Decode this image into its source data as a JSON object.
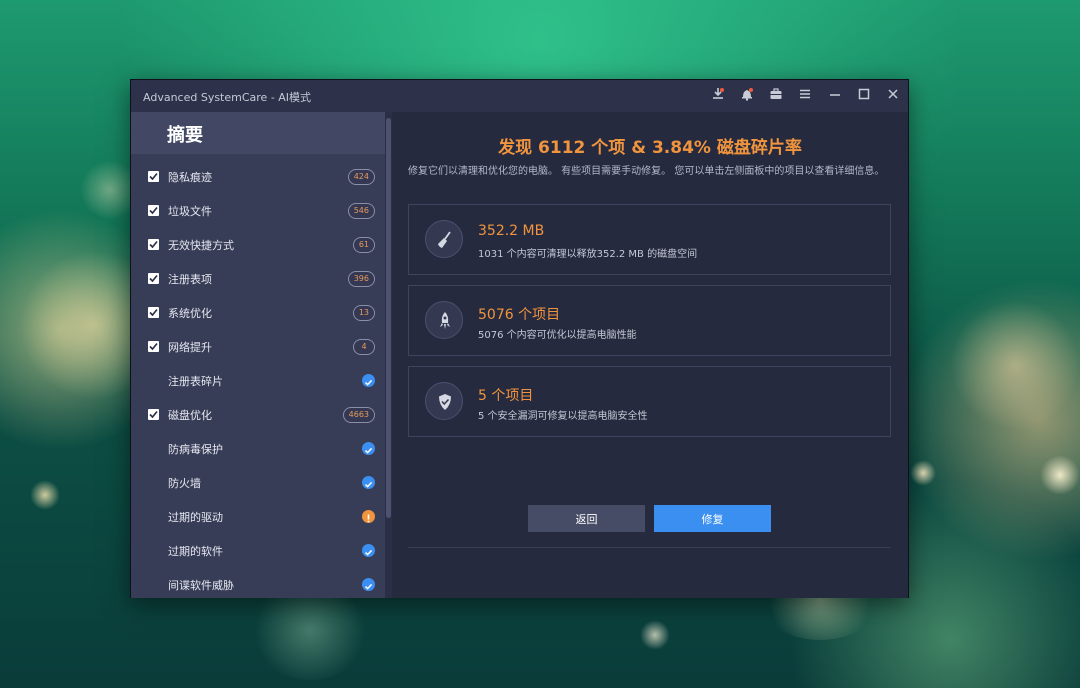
{
  "window": {
    "title": "Advanced SystemCare - AI模式"
  },
  "sidebar": {
    "header": "摘要",
    "items": [
      {
        "label": "隐私痕迹",
        "checked": true,
        "badge": "424"
      },
      {
        "label": "垃圾文件",
        "checked": true,
        "badge": "546"
      },
      {
        "label": "无效快捷方式",
        "checked": true,
        "badge": "61"
      },
      {
        "label": "注册表项",
        "checked": true,
        "badge": "396"
      },
      {
        "label": "系统优化",
        "checked": true,
        "badge": "13"
      },
      {
        "label": "网络提升",
        "checked": true,
        "badge": "4"
      },
      {
        "label": "注册表碎片",
        "checked": false,
        "status": "ok"
      },
      {
        "label": "磁盘优化",
        "checked": true,
        "badge": "4663"
      },
      {
        "label": "防病毒保护",
        "checked": false,
        "status": "ok"
      },
      {
        "label": "防火墙",
        "checked": false,
        "status": "ok"
      },
      {
        "label": "过期的驱动",
        "checked": false,
        "status": "warning"
      },
      {
        "label": "过期的软件",
        "checked": false,
        "status": "ok"
      },
      {
        "label": "间谍软件威胁",
        "checked": false,
        "status": "ok"
      }
    ]
  },
  "main": {
    "headline": "发现 6112 个项 & 3.84% 磁盘碎片率",
    "description": "修复它们以清理和优化您的电脑。 有些项目需要手动修复。 您可以单击左侧面板中的项目以查看详细信息。",
    "cards": [
      {
        "icon": "broom-icon",
        "title": "352.2 MB",
        "subtitle": "1031 个内容可清理以释放352.2 MB 的磁盘空间"
      },
      {
        "icon": "rocket-icon",
        "title": "5076 个项目",
        "subtitle": "5076 个内容可优化以提高电脑性能"
      },
      {
        "icon": "shield-icon",
        "title": "5 个项目",
        "subtitle": "5 个安全漏洞可修复以提高电脑安全性"
      }
    ],
    "back_label": "返回",
    "fix_label": "修复"
  },
  "colors": {
    "accent": "#f0943e",
    "primary_button": "#3b8ff0",
    "ok": "#3b8ff0",
    "warning": "#f0943e"
  }
}
